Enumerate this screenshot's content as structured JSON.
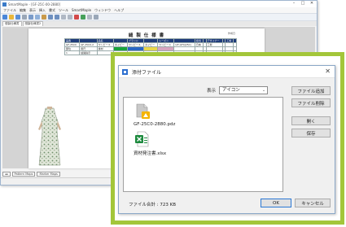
{
  "app": {
    "title": "SmartMaple - [GF-25C-00-2880]",
    "menu": [
      "ファイル",
      "編集",
      "表示",
      "挿入",
      "書式",
      "ツール",
      "SmartMaple",
      "ウィンドウ",
      "ヘルプ"
    ],
    "doc_tabs": [
      "縫製仕様書",
      "縫製仕様書2"
    ],
    "sheet_tabs": [
      "Pattern Maps",
      "Marker Maps"
    ]
  },
  "sheet": {
    "title": "縫 製 仕 様 書",
    "meta": "作成日",
    "header_cells": [
      "品番",
      "",
      "品名",
      "",
      "ブランド",
      "",
      "シーズン",
      "",
      "担当",
      "",
      "デザイナー",
      "",
      "工場",
      "",
      "",
      ""
    ],
    "row1": [
      "GF-25C0",
      "GF-25C0-2",
      "ワンピース",
      "ネイビー",
      "ワンピース",
      "ネイビー",
      "ワンピース",
      "GF-GF4(25C)",
      "日本",
      "",
      "工場",
      "",
      "",
      "",
      "",
      ""
    ],
    "row2": [
      "部位",
      "用尺",
      "素材",
      "",
      "",
      "",
      "",
      "",
      "",
      "",
      "",
      "",
      "",
      "",
      "",
      ""
    ],
    "row3": [
      "1",
      "縫製指示",
      "",
      "",
      "",
      "",
      "",
      "",
      "",
      "",
      "",
      "",
      "",
      "",
      "",
      ""
    ]
  },
  "dialog": {
    "title": "添付ファイル",
    "close_icon": "close-icon",
    "view_label": "表示",
    "view_value": "アイコン",
    "files": [
      {
        "name": "GF-25C0-2880.pdz",
        "icon": "pdz-file-icon",
        "accent": "#f5b400"
      },
      {
        "name": "資材発注書.xlsx",
        "icon": "excel-file-icon",
        "accent": "#1d8a3e"
      }
    ],
    "buttons": {
      "add": "ファイル追加",
      "delete": "ファイル削除",
      "open": "開く",
      "save": "保存",
      "ok": "OK",
      "cancel": "キャンセル"
    },
    "total_size": "ファイル合計 : 723 KB"
  },
  "colors": {
    "highlight_frame": "#a3c63a",
    "titlebar_icon": "#2c6fd0"
  }
}
